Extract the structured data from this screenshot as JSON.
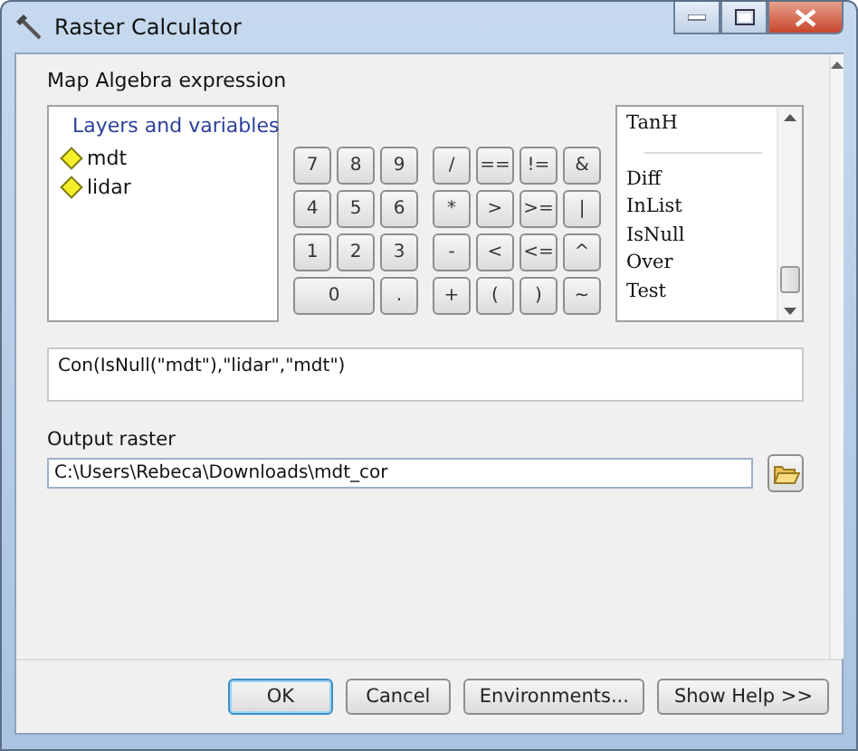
{
  "window": {
    "title": "Raster Calculator"
  },
  "expression_label": "Map Algebra expression",
  "layers": {
    "title": "Layers and variables",
    "items": [
      {
        "label": "mdt"
      },
      {
        "label": "lidar"
      }
    ]
  },
  "keypad": {
    "digits": [
      [
        {
          "label": "7"
        },
        {
          "label": "8"
        },
        {
          "label": "9"
        }
      ],
      [
        {
          "label": "4"
        },
        {
          "label": "5"
        },
        {
          "label": "6"
        }
      ],
      [
        {
          "label": "1"
        },
        {
          "label": "2"
        },
        {
          "label": "3"
        }
      ],
      [
        {
          "label": "0",
          "wide": true
        },
        {
          "label": "."
        }
      ]
    ],
    "operators": [
      [
        {
          "label": "/"
        },
        {
          "label": "=="
        },
        {
          "label": "!="
        },
        {
          "label": "&"
        }
      ],
      [
        {
          "label": "*"
        },
        {
          "label": ">"
        },
        {
          "label": ">="
        },
        {
          "label": "|"
        }
      ],
      [
        {
          "label": "-"
        },
        {
          "label": "<"
        },
        {
          "label": "<="
        },
        {
          "label": "^"
        }
      ],
      [
        {
          "label": "+"
        },
        {
          "label": "("
        },
        {
          "label": ")"
        },
        {
          "label": "~"
        }
      ]
    ]
  },
  "functions": [
    {
      "label": "TanH",
      "kind": "item"
    },
    {
      "kind": "separator"
    },
    {
      "label": "Diff",
      "kind": "item"
    },
    {
      "label": "InList",
      "kind": "item"
    },
    {
      "label": "IsNull",
      "kind": "item"
    },
    {
      "label": "Over",
      "kind": "item"
    },
    {
      "label": "Test",
      "kind": "item"
    }
  ],
  "expression": "Con(IsNull(\"mdt\"),\"lidar\",\"mdt\")",
  "output": {
    "label": "Output raster",
    "value": "C:\\Users\\Rebeca\\Downloads\\mdt_cor"
  },
  "buttons": [
    {
      "label": "OK",
      "default": true
    },
    {
      "label": "Cancel",
      "default": false
    },
    {
      "label": "Environments...",
      "default": false
    },
    {
      "label": "Show Help >>",
      "default": false
    }
  ]
}
